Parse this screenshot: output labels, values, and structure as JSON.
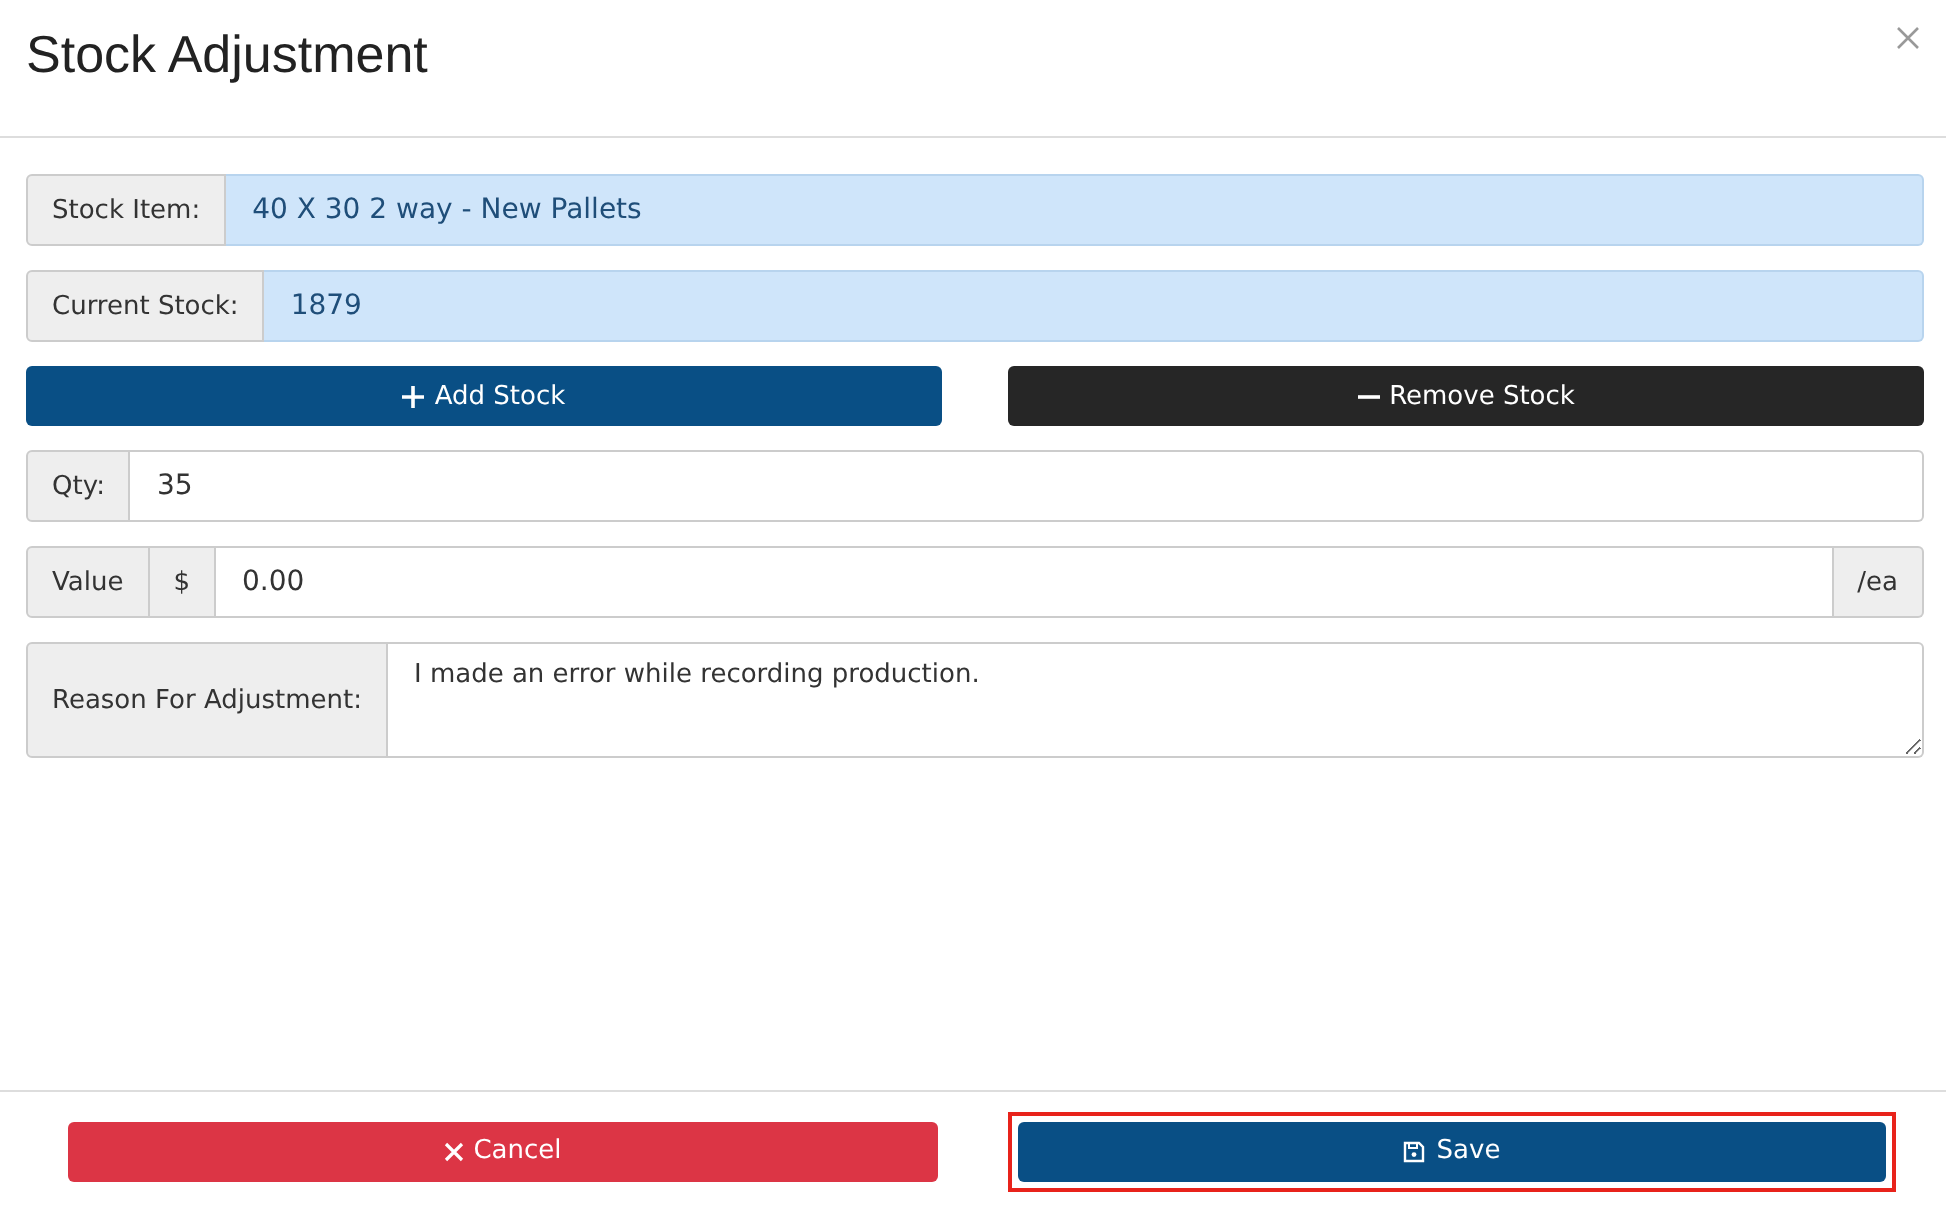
{
  "dialog": {
    "title": "Stock Adjustment"
  },
  "stock_item": {
    "label": "Stock Item:",
    "value": "40 X 30 2 way - New Pallets"
  },
  "current_stock": {
    "label": "Current Stock:",
    "value": "1879"
  },
  "actions": [
    {
      "kind": "add",
      "label": "Add Stock"
    },
    {
      "kind": "remove",
      "label": "Remove Stock"
    }
  ],
  "qty": {
    "label": "Qty:",
    "value": "35"
  },
  "value": {
    "label": "Value",
    "prefix": "$",
    "value": "0.00",
    "suffix": "/ea"
  },
  "reason": {
    "label": "Reason For Adjustment:",
    "value": "I made an error while recording production."
  },
  "footer_buttons": [
    {
      "kind": "cancel",
      "label": "Cancel",
      "highlighted": false
    },
    {
      "kind": "save",
      "label": "Save",
      "highlighted": true
    }
  ]
}
